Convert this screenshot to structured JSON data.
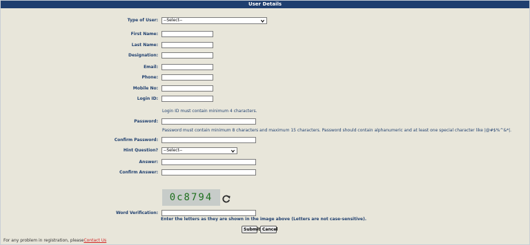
{
  "header": {
    "title": "User Details"
  },
  "form": {
    "type_of_user": {
      "label": "Type of User:",
      "value": "--Select--"
    },
    "first_name": {
      "label": "First Name:",
      "value": ""
    },
    "last_name": {
      "label": "Last Name:",
      "value": ""
    },
    "designation": {
      "label": "Designation:",
      "value": ""
    },
    "email": {
      "label": "Email:",
      "value": ""
    },
    "phone": {
      "label": "Phone:",
      "value": ""
    },
    "mobile": {
      "label": "Mobile No:",
      "value": ""
    },
    "login_id": {
      "label": "Login ID:",
      "value": "",
      "hint": "Login ID must contain minimum 4 characters."
    },
    "password": {
      "label": "Password:",
      "value": "",
      "hint": "Password must contain minimum 8 characters and maximum 15 characters. Password should contain alphanumeric and at least one special character like |@#$%^&*|."
    },
    "confirm_password": {
      "label": "Confirm Password:",
      "value": ""
    },
    "hint_question": {
      "label": "Hint Question?",
      "value": "--Select--"
    },
    "answer": {
      "label": "Answer:",
      "value": ""
    },
    "confirm_answer": {
      "label": "Confirm Answer:",
      "value": ""
    },
    "captcha": {
      "text": "0c8794"
    },
    "word_verification": {
      "label": "Word Verification:",
      "value": "",
      "note": "Enter the letters as they are shown in the image above (Letters are not case-sensitive)."
    }
  },
  "buttons": {
    "submit": "Submit",
    "cancel": "Cancel"
  },
  "footer": {
    "text": "For any problem in registration, please",
    "link": "Contact Us"
  },
  "colors": {
    "header": "#1f3f6f",
    "panel": "#e8e6da",
    "link": "#d21f1f",
    "captcha_text": "#1d6f1d"
  }
}
